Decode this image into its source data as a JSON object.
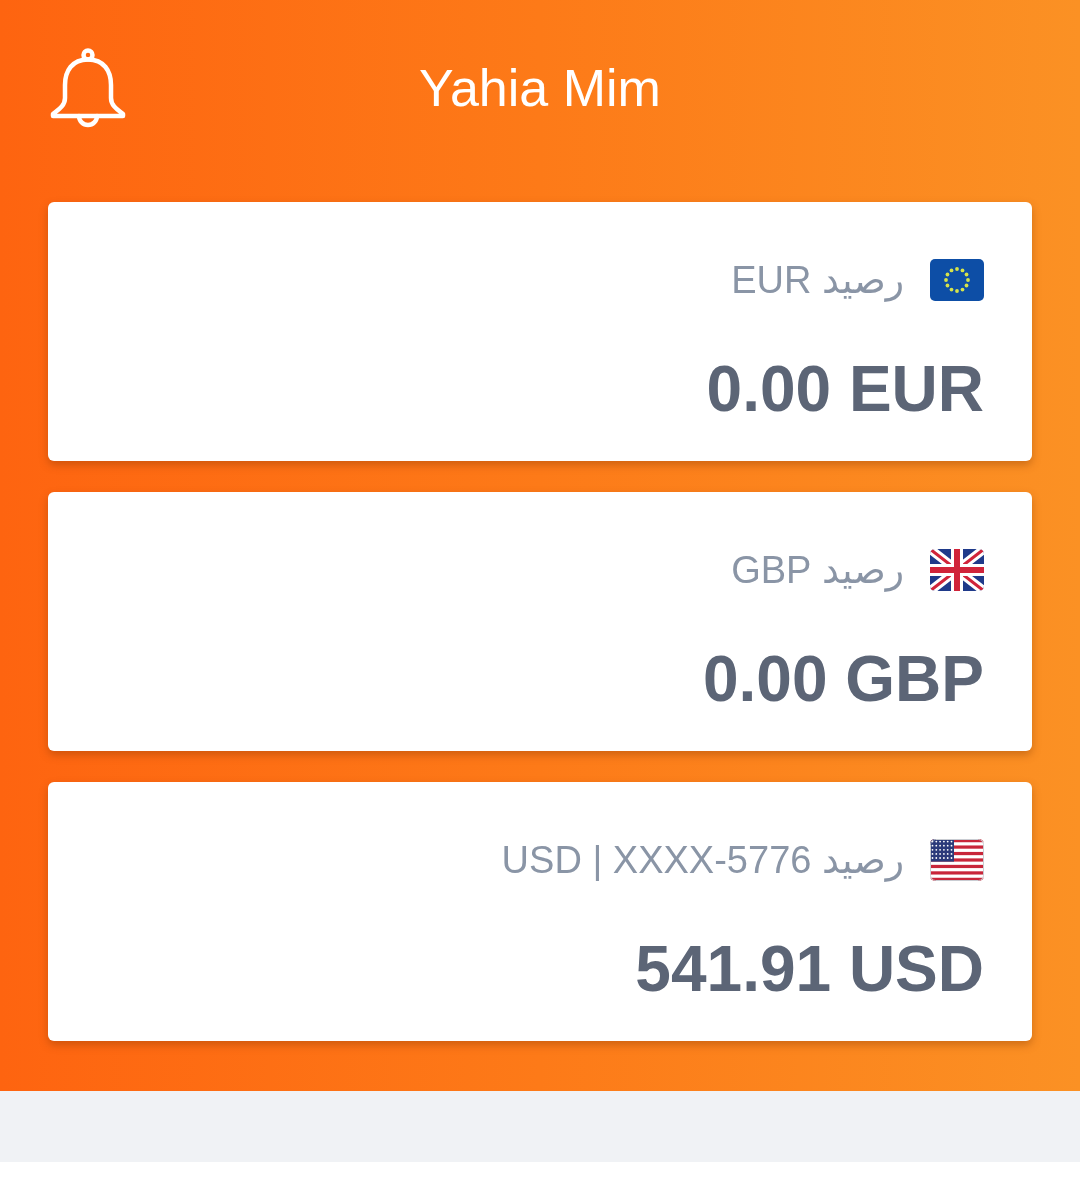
{
  "header": {
    "title": "Yahia Mim"
  },
  "accounts": [
    {
      "kind": "eu",
      "label": "رصيد EUR",
      "balance": "0.00 EUR"
    },
    {
      "kind": "gb",
      "label": "رصيد GBP",
      "balance": "0.00 GBP"
    },
    {
      "kind": "us",
      "label": "رصيد USD | XXXX-5776",
      "balance": "541.91 USD"
    }
  ]
}
